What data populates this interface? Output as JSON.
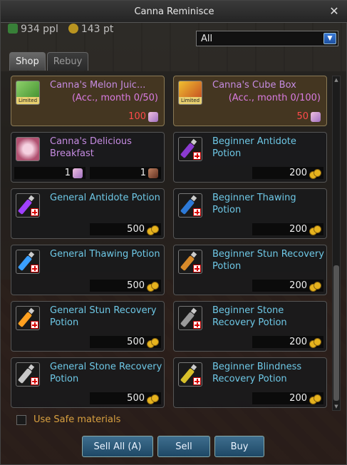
{
  "window": {
    "title": "Canna Reminisce"
  },
  "status": {
    "people": "934 ppl",
    "points": "143 pt"
  },
  "filter": {
    "selected": "All"
  },
  "tabs": [
    {
      "label": "Shop",
      "active": true
    },
    {
      "label": "Rebuy",
      "active": false
    }
  ],
  "items": [
    {
      "name": "Canna's Melon Juic...",
      "sub": "(Acc., month 0/50)",
      "price": "100",
      "price_red": true,
      "limited": true,
      "icon": "melon-juice-icon",
      "name_color": "purple",
      "currency": "material"
    },
    {
      "name": "Canna's Cube Box",
      "sub": "(Acc., month 0/100)",
      "price": "50",
      "price_red": true,
      "limited": true,
      "icon": "cube-box-icon",
      "name_color": "purple",
      "currency": "material"
    },
    {
      "name": "Canna's Delicious Breakfast",
      "sub": "",
      "price_left": "1",
      "price": "1",
      "limited": false,
      "icon": "breakfast-icon",
      "name_color": "purple",
      "currency": "material"
    },
    {
      "name": "Beginner Antidote Potion",
      "price": "200",
      "icon": "antidote-potion-icon",
      "color": "#8a3ad0",
      "currency": "gold"
    },
    {
      "name": "General Antidote Potion",
      "price": "500",
      "icon": "antidote-potion-icon",
      "color": "#a040ff",
      "currency": "gold"
    },
    {
      "name": "Beginner Thawing Potion",
      "price": "200",
      "icon": "thawing-potion-icon",
      "color": "#2d7ad8",
      "currency": "gold"
    },
    {
      "name": "General Thawing Potion",
      "price": "500",
      "icon": "thawing-potion-icon",
      "color": "#3aa0ff",
      "currency": "gold"
    },
    {
      "name": "Beginner Stun Recovery Potion",
      "price": "200",
      "icon": "stun-potion-icon",
      "color": "#d88a2a",
      "currency": "gold"
    },
    {
      "name": "General Stun Recovery Potion",
      "price": "500",
      "icon": "stun-potion-icon",
      "color": "#ffa020",
      "currency": "gold"
    },
    {
      "name": "Beginner Stone Recovery Potion",
      "price": "200",
      "icon": "stone-potion-icon",
      "color": "#9a9a9a",
      "currency": "gold"
    },
    {
      "name": "General Stone Recovery Potion",
      "price": "500",
      "icon": "stone-potion-icon",
      "color": "#c8c8c8",
      "currency": "gold"
    },
    {
      "name": "Beginner Blindness Recovery Potion",
      "price": "200",
      "icon": "blindness-potion-icon",
      "color": "#d8c02a",
      "currency": "gold"
    }
  ],
  "safe_materials": {
    "label": "Use Safe materials",
    "checked": false
  },
  "buttons": {
    "sell_all": "Sell All (A)",
    "sell": "Sell",
    "buy": "Buy"
  }
}
